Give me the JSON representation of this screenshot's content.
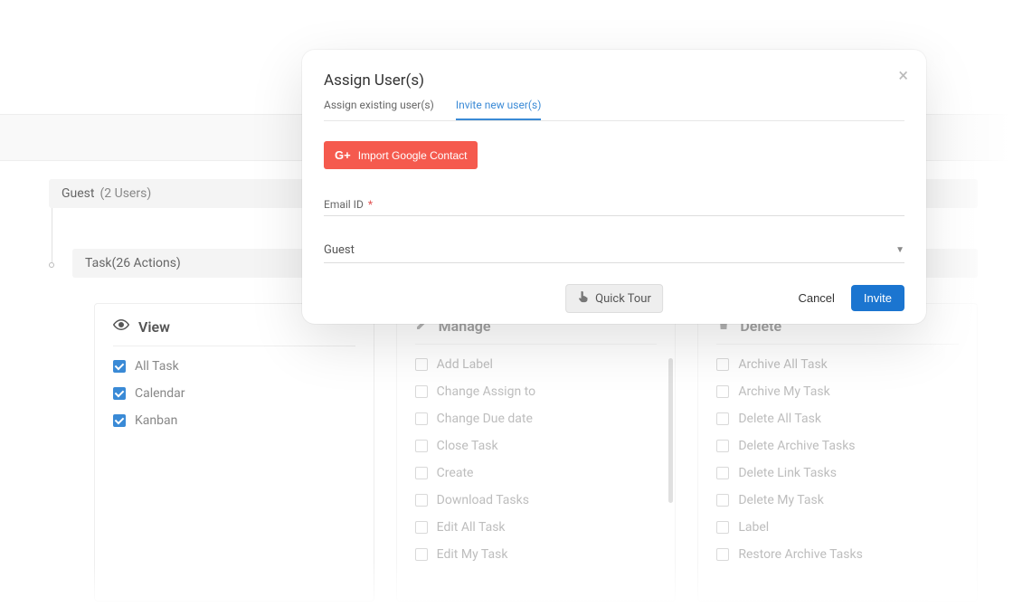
{
  "permissions": {
    "group": {
      "name": "Guest",
      "count_label": "(2 Users)"
    },
    "section": {
      "name": "Task",
      "count_label": "(26 Actions)"
    },
    "columns": {
      "view": {
        "title": "View",
        "items": [
          "All Task",
          "Calendar",
          "Kanban"
        ]
      },
      "manage": {
        "title": "Manage",
        "items": [
          "Add Label",
          "Change Assign to",
          "Change Due date",
          "Close Task",
          "Create",
          "Download Tasks",
          "Edit All Task",
          "Edit My Task"
        ]
      },
      "delete": {
        "title": "Delete",
        "items": [
          "Archive All Task",
          "Archive My Task",
          "Delete All Task",
          "Delete Archive Tasks",
          "Delete Link Tasks",
          "Delete My Task",
          "Label",
          "Restore Archive Tasks"
        ]
      }
    }
  },
  "modal": {
    "title": "Assign User(s)",
    "tabs": {
      "existing": "Assign existing user(s)",
      "invite": "Invite new user(s)"
    },
    "google_button": "Import Google Contact",
    "email_label": "Email ID",
    "role_selected": "Guest",
    "cancel": "Cancel",
    "invite": "Invite",
    "quick_tour": "Quick Tour"
  }
}
